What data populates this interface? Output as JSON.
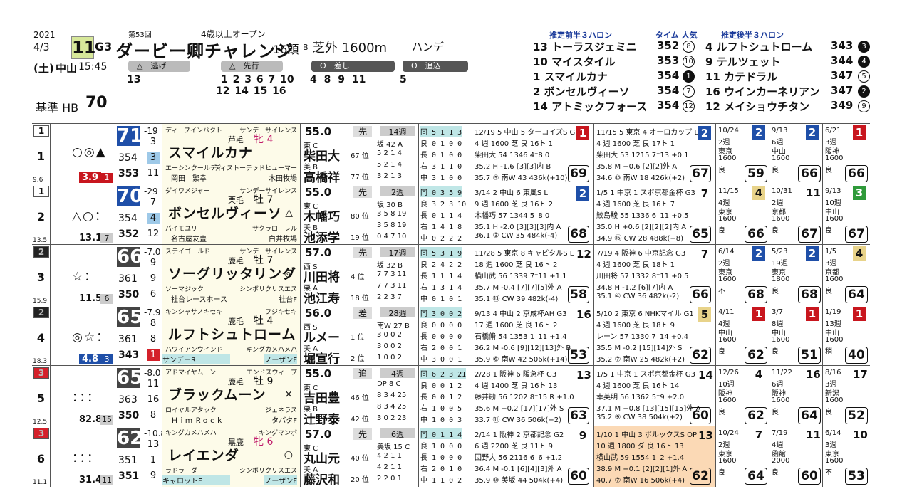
{
  "header": {
    "year": "2021",
    "date": "4/3",
    "day": "(土)",
    "course": "中山",
    "time": "15:45",
    "race_no": "11",
    "grade": "G3",
    "edition": "第53回",
    "condition": "4歳以上オープン",
    "title": "ダービー卿チャレンジ",
    "runners": "16頭",
    "track_cond": "B",
    "distance": "芝外 1600m",
    "handicap": "ハンデ",
    "base_label": "基準 HB",
    "base_value": "70"
  },
  "styles": [
    {
      "label": "△　逃げ",
      "nums": "13"
    },
    {
      "label": "△　先行",
      "nums1": "1 2 3 6 7 10",
      "nums2": "12 14 15 16"
    },
    {
      "label": "O　差し",
      "nums": "4 8 9 11"
    },
    {
      "label": "O　追込",
      "nums": "5"
    }
  ],
  "pace": {
    "head_front": "推定前半３ハロン",
    "head_time": "タイム 人気",
    "head_back": "推定後半３ハロン",
    "front": [
      {
        "name": "13 トーラスジェミニ",
        "time": "352",
        "pop": "8"
      },
      {
        "name": "10 マイスタイル",
        "time": "353",
        "pop": "10"
      },
      {
        "name": "1 スマイルカナ",
        "time": "354",
        "pop": "1"
      },
      {
        "name": "2 ボンセルヴィーソ",
        "time": "354",
        "pop": "7"
      },
      {
        "name": "14 アトミックフォース",
        "time": "354",
        "pop": "12"
      }
    ],
    "back": [
      {
        "name": "4 ルフトシュトローム",
        "time": "343",
        "pop": "3"
      },
      {
        "name": "9 テルツェット",
        "time": "344",
        "pop": "4"
      },
      {
        "name": "11 カテドラル",
        "time": "347",
        "pop": "5"
      },
      {
        "name": "16 ウインカーネリアン",
        "time": "347",
        "pop": "2"
      },
      {
        "name": "12 メイショウチタン",
        "time": "349",
        "pop": "9"
      }
    ]
  },
  "horses": [
    {
      "waku": "1",
      "num": "1",
      "odds_small": "9.6",
      "marks": "○◎▲",
      "odds": "3.9",
      "pop": "1",
      "rating": "71",
      "rcolor": "#1f4fa8",
      "rdiff": "-19",
      "r_a": "3",
      "r_b1": "354",
      "r_b2": "3",
      "r_c1": "353",
      "r_c2": "11",
      "sire": "ディープインパクト",
      "bms": "サンデーサイレンス",
      "color": "芦毛",
      "sex": "牝 4",
      "name": "スマイルカナ",
      "mk": "",
      "dam": "エーシンクールディ",
      "damsire": "ディストーテッドヒューマー",
      "trainer": "岡田　繁幸",
      "owner": "木田牧場",
      "weight": "55.0",
      "style": "先",
      "jr1": "東 C",
      "j1": "柴田大",
      "jp1": "67 位",
      "jr2": "美 B",
      "j2": "高橋祥",
      "jp2": "77 位",
      "stat_h": "14週",
      "stat": [
        "坂 42 A",
        "5 2 1 4",
        "5 2 1 4",
        "3 2 1 3"
      ],
      "rec": [
        "同 5 1 1 3",
        "良 0 1 0 0",
        "長 0 1 0 0",
        "右 3 1 1 0",
        "中 3 1 0 0"
      ],
      "r1": [
        "12/19 5 中山 5 ターコイズS G3",
        "4 週 1600 芝 良 16ト 1",
        "柴田大 54 1346 4⁻8 0",
        "35.2 H -1.6 [3][3]内 B",
        "35.7 ⑤ 南W 43 436k(+10)"
      ],
      "r1fin": "1",
      "r1finc": "#c8161e",
      "r1sc": "69",
      "r2": [
        "11/15 5 東京 4 オーロカップ L",
        "4 週 1600 芝 良 17ト 1",
        "柴田大 53 1215 7⁻13 +0.1",
        "35.8 M +0.6 [2][2]外 A",
        "34.6 ⑩ 南W 18 426k(+2)"
      ],
      "r2fin": "2",
      "r2finc": "#1f4fa8",
      "r2sc": "67",
      "o1": [
        "10/24",
        "2週",
        "東京",
        "1600",
        "良"
      ],
      "o1fin": "2",
      "o1c": "#1f4fa8",
      "o1sc": "59",
      "o2": [
        "9/13",
        "6週",
        "中山",
        "1600",
        "良"
      ],
      "o2fin": "2",
      "o2c": "#1f4fa8",
      "o2sc": "66",
      "o3": [
        "6/21",
        "3週",
        "阪神",
        "1600",
        "良"
      ],
      "o3fin": "1",
      "o3c": "#c8161e",
      "o3sc": "66"
    },
    {
      "waku": "1",
      "num": "2",
      "odds_small": "13.5",
      "marks": "△○：",
      "odds": "13.1",
      "pop": "7",
      "rating": "70",
      "rcolor": "#1f4fa8",
      "rdiff": "-29",
      "r_a": "7",
      "r_b1": "354",
      "r_b2": "4",
      "r_c1": "352",
      "r_c2": "12",
      "sire": "ダイワメジャー",
      "bms": "サンデーサイレンス",
      "color": "栗毛",
      "sex": "牡 7",
      "name": "ボンセルヴィーソ",
      "mk": "△",
      "dam": "バイモユリ",
      "damsire": "サクラローレル",
      "trainer": "名古屋友豊",
      "owner": "白井牧場",
      "weight": "55.0",
      "style": "先",
      "jr1": "東 C",
      "j1": "木幡巧",
      "jp1": "80 位",
      "jr2": "美 B",
      "j2": "池添学",
      "jp2": "19 位",
      "stat_h": "2週",
      "stat": [
        "坂 30 B",
        "3 5 8 19",
        "3 5 8 19",
        "0 4 7 10"
      ],
      "rec": [
        "同 0 3 5 9",
        "良 3 2 3 10",
        "長 0 1 1 4",
        "右 1 4 1 8",
        "中 0 2 2 2"
      ],
      "r1": [
        "3/14 2 中山 6 東風S L",
        "9 週 1600 芝 良 16ト 2",
        "木幡巧 57 1344 5⁻8 0",
        "35.1 H -2.0 [3][3][3]内 A",
        "36.1 ③ CW 35 484k(-4)"
      ],
      "r1fin": "2",
      "r1finc": "#1f4fa8",
      "r1sc": "68",
      "r2": [
        "1/5 1 中京 1 スポ京都金杯 G3",
        "4 週 1600 芝 良 16ト 7",
        "鮫島駿 55 1336 6⁻11 +0.5",
        "35.0 H +0.6 [2][2][2]内 A",
        "34.9 ⑮ CW 28 488k(+8)"
      ],
      "r2fin": "7",
      "r2finc": "",
      "r2sc": "65",
      "o1": [
        "11/15",
        "4週",
        "東京",
        "1600",
        "良"
      ],
      "o1fin": "4",
      "o1c": "#e8d38a",
      "o1sc": "66",
      "o2": [
        "10/31",
        "2週",
        "京都",
        "1600",
        "良"
      ],
      "o2fin": "11",
      "o2c": "",
      "o2sc": "67",
      "o3": [
        "9/13",
        "10週",
        "中山",
        "1600",
        "良"
      ],
      "o3fin": "3",
      "o3c": "#2f9a3a",
      "o3sc": "67"
    },
    {
      "waku": "2",
      "num": "3",
      "odds_small": "15.9",
      "marks": "☆：",
      "odds": "11.5",
      "pop": "6",
      "rating": "66",
      "rcolor": "#444",
      "rdiff": "-7.0",
      "r_a": "9",
      "r_b1": "361",
      "r_b2": "9",
      "r_c1": "350",
      "r_c2": "6",
      "sire": "ステイゴールド",
      "bms": "サンデーサイレンス",
      "color": "鹿毛",
      "sex": "牡 7",
      "name": "ソーグリッタリング",
      "mk": "◎",
      "dam": "ソーマジック",
      "damsire": "シンボリクリスエス",
      "trainer": "社台レースホース",
      "owner": "社台F",
      "weight": "57.0",
      "style": "先",
      "jr1": "西 S",
      "j1": "川田将",
      "jp1": "4 位",
      "jr2": "栗 A",
      "j2": "池江寿",
      "jp2": "18 位",
      "stat_h": "17週",
      "stat": [
        "坂 32 B",
        "7 7 3 11",
        "7 7 3 11",
        "2 2 3 7"
      ],
      "rec": [
        "同 5 3 1 9",
        "良 2 4 2 2",
        "長 1 1 1 4",
        "右 1 3 1 4",
        "中 0 1 0 1"
      ],
      "r1": [
        "11/28 5 東京 8 キャピタルS L",
        "18 週 1600 芝 良 16ト 2",
        "横山武 56 1339 7⁻11 +1.1",
        "35.7 M -0.4 [7][7][5]外 A",
        "35.1 ⑬ CW 39 482k(-4)"
      ],
      "r1fin": "12",
      "r1finc": "",
      "r1sc": "58",
      "r2": [
        "7/19 4 阪神 6 中京記念 G3",
        "4 週 1600 芝 良 18ト 1",
        "川田将 57 1332 8⁻11 +0.5",
        "34.8 H -1.2 [6][7]内 A",
        "35.1 ④ CW 36 482k(-2)"
      ],
      "r2fin": "7",
      "r2finc": "",
      "r2sc": "66",
      "o1": [
        "6/14",
        "2週",
        "東京",
        "1600",
        "不"
      ],
      "o1fin": "2",
      "o1c": "#1f4fa8",
      "o1sc": "68",
      "o2": [
        "5/23",
        "19週",
        "東京",
        "1800",
        "良"
      ],
      "o2fin": "2",
      "o2c": "#1f4fa8",
      "o2sc": "68",
      "o3": [
        "1/5",
        "3週",
        "京都",
        "1600",
        "良"
      ],
      "o3fin": "4",
      "o3c": "#e8d38a",
      "o3sc": "64"
    },
    {
      "waku": "2",
      "num": "4",
      "odds_small": "18.3",
      "marks": "◎☆：",
      "odds": "4.8",
      "pop": "3",
      "rating": "65",
      "rcolor": "#444",
      "rdiff": "-7.9",
      "r_a": "8",
      "r_b1": "361",
      "r_b2": "8",
      "r_c1": "343",
      "r_c2": "1",
      "sire": "キンシャサノキセキ",
      "bms": "フジキセキ",
      "color": "鹿毛",
      "sex": "牡 4",
      "name": "ルフトシュトローム",
      "mk": "",
      "dam": "ハワイアンウインド",
      "damsire": "キングカメハメハ",
      "trainer": "サンデーR",
      "owner": "ノーザンF",
      "weight": "56.0",
      "style": "差",
      "jr1": "西 S",
      "j1": "ルメー",
      "jp1": "1 位",
      "jr2": "美 A",
      "j2": "堀宣行",
      "jp2": "2 位",
      "stat_h": "28週",
      "stat": [
        "南W 27 B",
        "3 0 0 2",
        "3 0 0 2",
        "1 0 0 2"
      ],
      "rec": [
        "同 3 0 0 2",
        "良 0 0 0 0",
        "長 0 0 0 0",
        "右 2 0 0 1",
        "中 3 0 0 1"
      ],
      "r1": [
        "9/13 4 中山 2 京成杯AH G3",
        "17 週 1600 芝 良 16ト 2",
        "石橋脩 54 1353 1⁻11 +1.4",
        "36.2 M -0.6 [9][12][13]外 B",
        "35.9 ⑥ 南W 42 506k(+14)"
      ],
      "r1fin": "16",
      "r1finc": "",
      "r1sc": "53",
      "r2": [
        "5/10 2 東京 6 NHKマイル G1",
        "4 週 1600 芝 良 18ト 9",
        "レーン 57 1330 7⁻14 +0.4",
        "35.5 M -0.2 [15][14]外 S",
        "35.2 ⑦ 南W 25 482k(+2)"
      ],
      "r2fin": "5",
      "r2finc": "#e8d38a",
      "r2sc": "62",
      "o1": [
        "4/11",
        "4週",
        "中山",
        "1600",
        "良"
      ],
      "o1fin": "1",
      "o1c": "#c8161e",
      "o1sc": "62",
      "o2": [
        "3/7",
        "8週",
        "中山",
        "1600",
        "良"
      ],
      "o2fin": "1",
      "o2c": "#c8161e",
      "o2sc": "51",
      "o3": [
        "1/19",
        "13週",
        "中山",
        "1600",
        "稍"
      ],
      "o3fin": "1",
      "o3c": "#c8161e",
      "o3sc": "40"
    },
    {
      "waku": "3",
      "num": "5",
      "odds_small": "12.5",
      "marks": "：：：",
      "odds": "82.8",
      "pop": "15",
      "rating": "65",
      "rcolor": "#444",
      "rdiff": "-8.0",
      "r_a": "11",
      "r_b1": "363",
      "r_b2": "16",
      "r_c1": "350",
      "r_c2": "8",
      "sire": "アドマイヤムーン",
      "bms": "エンドスウィープ",
      "color": "鹿毛",
      "sex": "牡 9",
      "name": "ブラックムーン",
      "mk": "×",
      "dam": "ロイヤルアタック",
      "damsire": "ジェネラス",
      "trainer": "Ｈｉｍ Ｒｏｃｋ",
      "owner": "タバタF",
      "weight": "55.0",
      "style": "追",
      "jr1": "東 C",
      "j1": "吉田豊",
      "jp1": "46 位",
      "jr2": "栗 B",
      "j2": "辻野泰",
      "jp2": "42 位",
      "stat_h": "4週",
      "stat": [
        "DP 8 C",
        "8 3 4 25",
        "8 3 4 25",
        "3 0 2 23"
      ],
      "rec": [
        "同 6 2 3 21",
        "良 0 0 1 2",
        "長 0 0 1 2",
        "右 1 0 0 5",
        "中 1 0 0 3"
      ],
      "r1": [
        "2/28 1 阪神 6 阪急杯 G3",
        "4 週 1400 芝 良 16ト 13",
        "藤井勘 56 1202 8⁻15 R +1.0",
        "35.6 M +0.2 [17][17]外 S",
        "33.7 ⑪ CW 36 506k(+2)"
      ],
      "r1fin": "13",
      "r1finc": "",
      "r1sc": "63",
      "r2": [
        "1/5 1 中京 1 スポ京都金杯 G3",
        "4 週 1600 芝 良 16ト 14",
        "幸英明 56 1362 5⁻9 +2.0",
        "37.1 M +0.8 [13][15][15]外 A",
        "35.2 ⑨ CW 38 504k(+2)"
      ],
      "r2fin": "14",
      "r2finc": "",
      "r2sc": "60",
      "o1": [
        "12/26",
        "10週",
        "阪神",
        "1600",
        "良"
      ],
      "o1fin": "4",
      "o1c": "",
      "o1sc": "62",
      "o2": [
        "11/22",
        "6週",
        "阪神",
        "1600",
        "良"
      ],
      "o2fin": "16",
      "o2c": "",
      "o2sc": "64",
      "o3": [
        "8/16",
        "3週",
        "新潟",
        "1600",
        "良"
      ],
      "o3fin": "17",
      "o3c": "",
      "o3sc": "52"
    },
    {
      "waku": "3",
      "num": "6",
      "odds_small": "11.1",
      "marks": "：：：",
      "odds": "31.4",
      "pop": "11",
      "rating": "62",
      "rcolor": "#444",
      "rdiff": "-10.8",
      "r_a": "13",
      "r_b1": "351",
      "r_b2": "1",
      "r_c1": "351",
      "r_c2": "9",
      "sire": "キングカメハメハ",
      "bms": "キングマンボ",
      "color": "黒鹿",
      "sex": "牝 6",
      "name": "レイエンダ",
      "mk": "○",
      "dam": "ラドラーダ",
      "damsire": "シンボリクリスエス",
      "trainer": "キャロットF",
      "owner": "ノーザンF",
      "weight": "57.0",
      "style": "先",
      "jr1": "東 C",
      "j1": "丸山元",
      "jp1": "40 位",
      "jr2": "美 A",
      "j2": "藤沢和",
      "jp2": "20 位",
      "stat_h": "6週",
      "stat": [
        "美坂 15 C",
        "4 2 1 1",
        "4 2 1 1",
        "2 2 0 1"
      ],
      "rec": [
        "同 0 1 1 4",
        "良 1 0 0 0",
        "長 1 0 0 0",
        "右 2 0 1 0",
        "中 1 1 0 2"
      ],
      "r1": [
        "2/14 1 阪神 2 京都記念 G2",
        "6 週 2200 芝 良 11ト 9",
        "団野大 56 2116 6⁻6 +1.2",
        "36.4 M -0.1 [6][4][3]外 A",
        "35.9 ⑩ 美坂 44 504k(+4)"
      ],
      "r1fin": "9",
      "r1finc": "",
      "r1sc": "60",
      "r2": [
        "1/10 1 中山 3 ポルックスS OP",
        "10 週 1800 ダ 良 16ト 13",
        "横山武 59 1554 1⁻2 +1.4",
        "38.9 M +0.1 [2][2][1]外 A",
        "40.7 ⑦ 南W 16 506k(+4)"
      ],
      "r2fin": "13",
      "r2finc": "",
      "r2sc": "62",
      "o1": [
        "10/24",
        "2週",
        "東京",
        "1600",
        "良"
      ],
      "o1fin": "7",
      "o1c": "",
      "o1sc": "64",
      "o2": [
        "7/19",
        "4週",
        "函館",
        "2000",
        "良"
      ],
      "o2fin": "11",
      "o2c": "",
      "o2sc": "60",
      "o3": [
        "6/14",
        "3週",
        "東京",
        "1600",
        "不"
      ],
      "o3fin": "10",
      "o3c": "",
      "o3sc": "53"
    }
  ],
  "waku_colors": {
    "1": "#ffffff",
    "2": "#222222",
    "3": "#d4202a"
  }
}
